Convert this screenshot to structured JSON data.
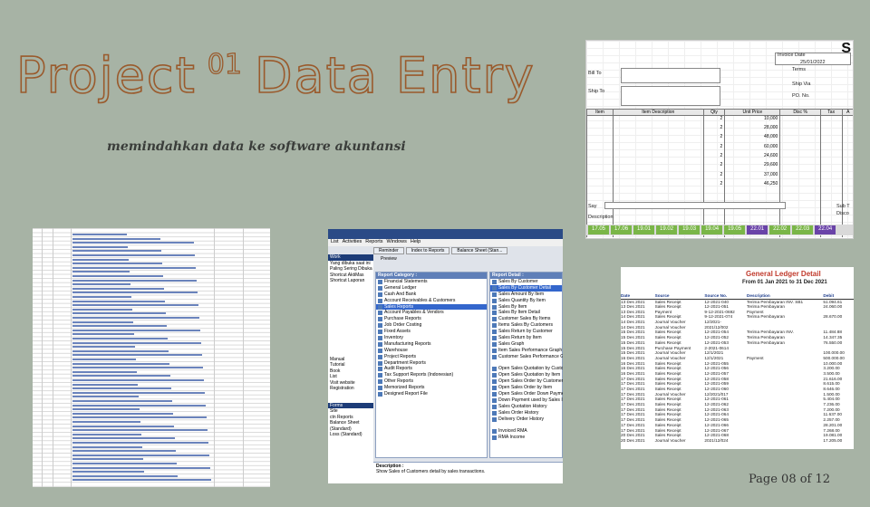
{
  "slide": {
    "title_word1": "Project",
    "title_number": "01",
    "title_word2": "Data Entry",
    "subtitle": "memindahkan data ke software akuntansi",
    "page_indicator": "Page 08 of 12"
  },
  "invoice": {
    "header_letter": "S",
    "invoice_date_label": "Invoice Date",
    "invoice_date": "25/01/2022",
    "terms_label": "Terms",
    "ship_via_label": "Ship Via",
    "po_label": "PO. No.",
    "bill_to_label": "Bill To",
    "ship_to_label": "Ship To",
    "columns": [
      "Item",
      "Item Description",
      "Qty",
      "Unit Price",
      "Disc %",
      "Tax",
      "A"
    ],
    "rows": [
      {
        "qty": "2",
        "price": "10,000"
      },
      {
        "qty": "2",
        "price": "28,000"
      },
      {
        "qty": "2",
        "price": "48,000"
      },
      {
        "qty": "2",
        "price": "60,000"
      },
      {
        "qty": "2",
        "price": "24,600"
      },
      {
        "qty": "2",
        "price": "29,600"
      },
      {
        "qty": "2",
        "price": "37,000"
      },
      {
        "qty": "2",
        "price": "46,250"
      }
    ],
    "say_label": "Say",
    "description_label": "Description",
    "sub_total_label": "Sub T",
    "discount_label": "Disco",
    "sheet_tabs": [
      "17.05",
      "17.06",
      "19.01",
      "19.02",
      "19.03",
      "19.04",
      "19.05",
      "22.01",
      "22.02",
      "22.03",
      "22.04"
    ]
  },
  "accounting_app": {
    "menu": [
      "List",
      "Activities",
      "Reports",
      "Windows",
      "Help"
    ],
    "tabs": [
      "Reminder",
      "Index to Reports",
      "Balance Sheet (Stan..."
    ],
    "preview_label": "Preview",
    "left_header": "Work",
    "left_items": [
      "Yang dibuka saat ini",
      "Paling Sering Dibuka",
      "Shortcut AktiMas",
      "Shortcut Laporan"
    ],
    "left_links": [
      "Manual",
      "Tutorial",
      "Book",
      "List",
      "Visit website",
      "Registration"
    ],
    "left_forms_header": "Forms",
    "left_forms": [
      "Site",
      "ctn Reports",
      "Balance Sheet (Standard)",
      "Loss (Standard)"
    ],
    "category_header": "Report Category :",
    "categories": [
      "Financial Statements",
      "General Ledger",
      "Cash And Bank",
      "Account Receivables & Customers",
      "Sales Reports",
      "Account Payables & Vendors",
      "Purchase Reports",
      "Job Order Costing",
      "Fixed Assets",
      "Inventory",
      "Manufacturing Reports",
      "Warehouse",
      "Project Reports",
      "Department Reports",
      "Audit Reports",
      "Tax Support Reports (Indonesian)",
      "Other Reports",
      "Memorized Reports",
      "Designed Report File"
    ],
    "selected_category": 4,
    "detail_header": "Report Detail :",
    "details": [
      "Sales By Customer",
      "Sales By Customer Detail",
      "Sales Amount By Item",
      "Sales Quantity By Item",
      "Sales By Item",
      "Sales By Item Detail",
      "Customer Sales By Items",
      "Items Sales By Customers",
      "Sales Return by Customer",
      "Sales Return by Item",
      "Sales Graph",
      "Item Sales Performance Graph",
      "Customer Sales Performance Graph",
      "",
      "Open Sales Quotation by Customer",
      "Open Sales Quotation by Item",
      "Open Sales Order by Customer",
      "Open Sales Order by Item",
      "Open Sales Order Down Payment",
      "Down Payment used by Sales Invoice",
      "Sales Quotation History",
      "Sales Order History",
      "Delivery Order History",
      "",
      "Invoiced RMA",
      "RMA Income"
    ],
    "selected_detail": 1,
    "description_label": "Description :",
    "description_text": "Show Sales of Customers detail by sales transactions."
  },
  "ledger": {
    "title": "General Ledger Detail",
    "period": "From 01 Jan 2021 to 31 Dec 2021",
    "columns": [
      "Date",
      "Source",
      "Source No.",
      "Description",
      "Debit"
    ],
    "rows": [
      [
        "13 Des 2021",
        "Sales Receipt",
        "12-2021-040",
        "Terima Pembayaran INV. SB1",
        "51.094.61"
      ],
      [
        "13 Des 2021",
        "Sales Receipt",
        "12-2021-051",
        "Terima Pembayaran",
        "24.060.00"
      ],
      [
        "13 Des 2021",
        "Payment",
        "9-12-2021-0692",
        "Payment",
        ""
      ],
      [
        "14 Des 2021",
        "Sales Receipt",
        "9-12-2021-074",
        "Terima Pembayaran",
        "28.670.00"
      ],
      [
        "14 Des 2021",
        "Journal Voucher",
        "12/2021-",
        "",
        ""
      ],
      [
        "14 Des 2021",
        "Journal Voucher",
        "2021/12/002",
        "",
        ""
      ],
      [
        "15 Des 2021",
        "Sales Receipt",
        "12-2021-054",
        "Terima Pembayaran INV.",
        "11.484.88"
      ],
      [
        "15 Des 2021",
        "Sales Receipt",
        "12-2021-052",
        "Terima Pembayaran",
        "14.347.35"
      ],
      [
        "15 Des 2021",
        "Sales Receipt",
        "12-2021-053",
        "Terima Pembayaran",
        "76.550.00"
      ],
      [
        "15 Des 2021",
        "Purchase Payment",
        "2-2021-0614",
        "",
        ""
      ],
      [
        "15 Des 2021",
        "Journal Voucher",
        "12/1/2021",
        "",
        "100.000.00"
      ],
      [
        "16 Des 2021",
        "Journal Voucher",
        "12/1/2021",
        "Payment",
        "500.000.00"
      ],
      [
        "16 Des 2021",
        "Sales Receipt",
        "12-2021-055",
        "",
        "10.000.00"
      ],
      [
        "16 Des 2021",
        "Sales Receipt",
        "12-2021-056",
        "",
        "3.200.00"
      ],
      [
        "16 Des 2021",
        "Sales Receipt",
        "12-2021-057",
        "",
        "3.500.00"
      ],
      [
        "17 Des 2021",
        "Sales Receipt",
        "12-2021-058",
        "",
        "21.616.00"
      ],
      [
        "17 Des 2021",
        "Sales Receipt",
        "12-2021-059",
        "",
        "8.615.00"
      ],
      [
        "17 Des 2021",
        "Sales Receipt",
        "12-2021-060",
        "",
        "8.646.00"
      ],
      [
        "17 Des 2021",
        "Journal Voucher",
        "12/2021/017",
        "",
        "1.500.00"
      ],
      [
        "17 Des 2021",
        "Sales Receipt",
        "12-2021-061",
        "",
        "5.404.00"
      ],
      [
        "17 Des 2021",
        "Sales Receipt",
        "12-2021-062",
        "",
        "7.236.00"
      ],
      [
        "17 Des 2021",
        "Sales Receipt",
        "12-2021-063",
        "",
        "7.200.00"
      ],
      [
        "17 Des 2021",
        "Sales Receipt",
        "12-2021-064",
        "",
        "11.637.00"
      ],
      [
        "17 Des 2021",
        "Sales Receipt",
        "12-2021-065",
        "",
        "2.257.00"
      ],
      [
        "17 Des 2021",
        "Sales Receipt",
        "12-2021-066",
        "",
        "28.201.00"
      ],
      [
        "17 Des 2021",
        "Sales Receipt",
        "12-2021-067",
        "",
        "7.268.00"
      ],
      [
        "20 Des 2021",
        "Sales Receipt",
        "12-2021-068",
        "",
        "19.081.00"
      ],
      [
        "20 Des 2021",
        "Journal Voucher",
        "2021/12/024",
        "",
        "17.205.00"
      ]
    ]
  }
}
